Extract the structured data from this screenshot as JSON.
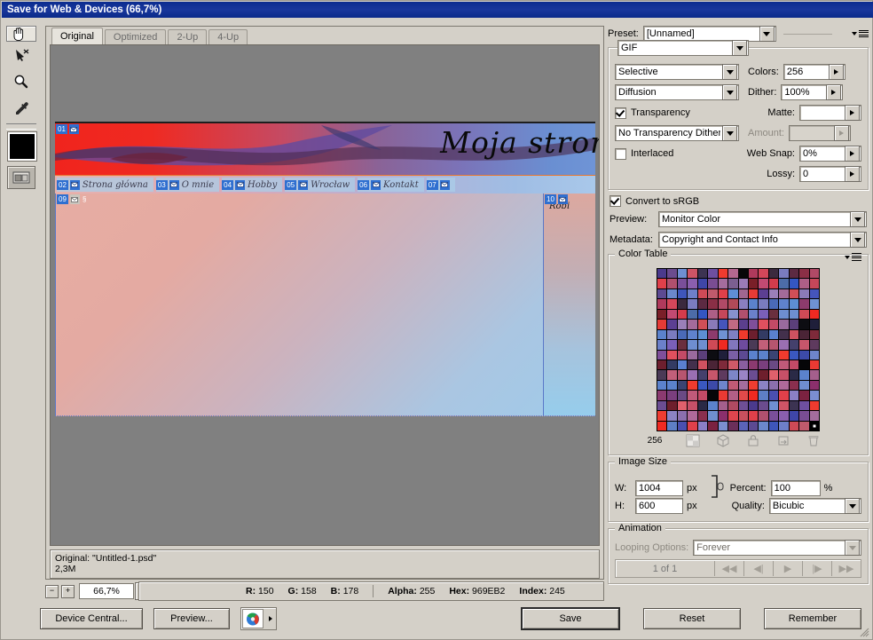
{
  "window": {
    "title": "Save for Web & Devices (66,7%)"
  },
  "toolbar": {
    "tools": [
      {
        "name": "hand-tool",
        "selected": true
      },
      {
        "name": "slice-select-tool",
        "selected": false
      },
      {
        "name": "zoom-tool",
        "selected": false
      },
      {
        "name": "eyedropper-tool",
        "selected": false
      }
    ],
    "foreground_color": "#000000",
    "toggle_slices_label": "Toggle Slices Visibility"
  },
  "view": {
    "tabs": [
      {
        "label": "Original",
        "active": true
      },
      {
        "label": "Optimized",
        "active": false
      },
      {
        "label": "2-Up",
        "active": false
      },
      {
        "label": "4-Up",
        "active": false
      }
    ]
  },
  "preview": {
    "banner_text": "Moja stronka",
    "nav_items": [
      {
        "num": "02",
        "label": "Strona główna"
      },
      {
        "num": "03",
        "label": "O mnie"
      },
      {
        "num": "04",
        "label": "Hobby"
      },
      {
        "num": "05",
        "label": "Wrocław"
      },
      {
        "num": "06",
        "label": "Kontakt"
      }
    ],
    "slices": [
      {
        "num": "01"
      },
      {
        "num": "07"
      },
      {
        "num": "09"
      },
      {
        "num": "10"
      }
    ],
    "right_col_text": "Robi",
    "colors": {
      "banner_start": "#f0241d",
      "banner_end": "#6f94d6",
      "body_start": "#e7ada3",
      "body_end": "#9fcbea",
      "nav_start": "#e8b2ae",
      "nav_end": "#a9c8ea",
      "slice_badge": "#2f6fd0"
    }
  },
  "info": {
    "line1": "Original: \"Untitled-1.psd\"",
    "line2": "2,3M"
  },
  "zoom": {
    "minus_label": "−",
    "plus_label": "+",
    "value": "66,7%"
  },
  "status": {
    "r_label": "R:",
    "r_value": "150",
    "g_label": "G:",
    "g_value": "158",
    "b_label": "B:",
    "b_value": "178",
    "alpha_label": "Alpha:",
    "alpha_value": "255",
    "hex_label": "Hex:",
    "hex_value": "969EB2",
    "index_label": "Index:",
    "index_value": "245"
  },
  "settings": {
    "preset_label": "Preset:",
    "preset_value": "[Unnamed]",
    "format_value": "GIF",
    "reduction_value": "Selective",
    "colors_label": "Colors:",
    "colors_value": "256",
    "dither_method_value": "Diffusion",
    "dither_label": "Dither:",
    "dither_value": "100%",
    "transparency_label": "Transparency",
    "transparency_checked": true,
    "matte_label": "Matte:",
    "matte_value": "",
    "transparency_dither_value": "No Transparency Dither",
    "amount_label": "Amount:",
    "amount_value": "",
    "interlaced_label": "Interlaced",
    "interlaced_checked": false,
    "web_snap_label": "Web Snap:",
    "web_snap_value": "0%",
    "lossy_label": "Lossy:",
    "lossy_value": "0",
    "convert_srgb_label": "Convert to sRGB",
    "convert_srgb_checked": true,
    "preview_label": "Preview:",
    "preview_value": "Monitor Color",
    "metadata_label": "Metadata:",
    "metadata_value": "Copyright and Contact Info"
  },
  "color_table": {
    "legend": "Color Table",
    "count": "256",
    "footer_icons": [
      "transparency-icon",
      "web-safe-cube-icon",
      "lock-icon",
      "new-color-icon",
      "delete-color-icon"
    ],
    "swatches": [
      "#4b3a8c",
      "#3f46a8",
      "#a06690",
      "#5f82cc",
      "#8177bd",
      "#3a4472",
      "#eb3a33",
      "#6b4c8e",
      "#7a4d93",
      "#e63b36",
      "#5d8ed3",
      "#6e4b9e",
      "#ee3b2e",
      "#b25f86",
      "#6f8fd2",
      "#a46d9d",
      "#5c3f92",
      "#8d3b6c",
      "#4a3a56",
      "#3a58c0",
      "#e04a4a",
      "#cf5466",
      "#7b5f90",
      "#9a7fb8",
      "#6f92d3",
      "#c25f79",
      "#3c4aa8",
      "#f02a22",
      "#3c3352",
      "#9b7bb6",
      "#a36b9a",
      "#7e80c2",
      "#b7556f",
      "#6e85cb",
      "#5e7fc6",
      "#6e4fa0",
      "#7a1f28",
      "#cf4f57",
      "#ee3a2c",
      "#9a6fb2",
      "#c05a75",
      "#4a4fb0",
      "#ef3b2f",
      "#c24a72",
      "#8a7bb8",
      "#6d1f2e",
      "#44406c",
      "#a46d9d",
      "#e0404a",
      "#b4678f",
      "#d33c4c",
      "#4555bb",
      "#333b63",
      "#c7566b",
      "#ef3d31",
      "#8a7fc6",
      "#070708",
      "#4c6ca8",
      "#c06a83",
      "#5a80cf",
      "#5e3a5e",
      "#8b83c4",
      "#7b2240",
      "#b03a5c",
      "#3456c2",
      "#5b3f8e",
      "#43304c",
      "#7d86c8",
      "#8b6fae",
      "#7b8ed0",
      "#d4475a",
      "#ad5f86",
      "#7f4f9a",
      "#cf5260",
      "#9a84c6",
      "#b06a9a",
      "#6a2f5a",
      "#3b2a3e",
      "#c6475a",
      "#e0505e",
      "#4a2436",
      "#6b4d92",
      "#8a2f4e",
      "#5b63b8",
      "#7a7cc0",
      "#8691ce",
      "#c34a66",
      "#7e2a3a",
      "#6e1f2c",
      "#6f8ed0",
      "#5c4a92",
      "#5c2a42",
      "#b0506e",
      "#9a6a9e",
      "#d05a68",
      "#e0606c",
      "#8b2f6c",
      "#6b88cc",
      "#8a2f46",
      "#6b80ca",
      "#5b3f7a",
      "#8a5fa0",
      "#c65068",
      "#e0454e",
      "#3e56bb",
      "#b04a66",
      "#7a5fb8",
      "#0d0d12",
      "#8b3a70",
      "#2a2a46",
      "#c8505e",
      "#6e7fc8",
      "#b04a58",
      "#6a2f3e",
      "#1f1f3a",
      "#7a3f7e",
      "#5b82cc",
      "#e0404a",
      "#cf4a56",
      "#8a7fc0",
      "#6e8ed0",
      "#7a5fa6",
      "#6a4a84",
      "#a45f8c",
      "#b0506e",
      "#c05a6c",
      "#5b82cc",
      "#6e8ed0",
      "#5c4a92",
      "#c05a7a",
      "#b04a62",
      "#7a4f9a",
      "#e0404a",
      "#7a7cc0",
      "#cf4a56",
      "#5b82cc",
      "#c34a66",
      "#6e4f96",
      "#8a5fae",
      "#5e8ed6",
      "#4a6ab8",
      "#f02a22",
      "#5b82cc",
      "#060608"
    ],
    "selected_index": 255
  },
  "image_size": {
    "legend": "Image Size",
    "w_label": "W:",
    "w_value": "1004",
    "w_unit": "px",
    "h_label": "H:",
    "h_value": "600",
    "h_unit": "px",
    "percent_label": "Percent:",
    "percent_value": "100",
    "percent_unit": "%",
    "quality_label": "Quality:",
    "quality_value": "Bicubic",
    "chain_icon": "link-icon"
  },
  "animation": {
    "legend": "Animation",
    "looping_label": "Looping Options:",
    "looping_value": "Forever",
    "frame_counter": "1 of 1",
    "buttons": [
      "first-frame",
      "previous-frame",
      "play",
      "next-frame",
      "last-frame"
    ]
  },
  "footer": {
    "device_central_label": "Device Central...",
    "preview_label": "Preview...",
    "browser_icon": "browser-icon",
    "save_label": "Save",
    "reset_label": "Reset",
    "remember_label": "Remember"
  }
}
